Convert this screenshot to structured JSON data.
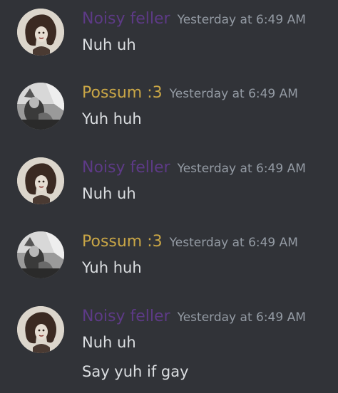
{
  "colors": {
    "background": "#313338",
    "timestamp": "#949ba4",
    "text": "#dbdee1",
    "noisy_feller": "#5d3a86",
    "possum": "#c9a646"
  },
  "messages": [
    {
      "author": "Noisy feller",
      "author_color": "#5d3a86",
      "avatar_icon": "noisy-feller-avatar",
      "timestamp": "Yesterday at 6:49 AM",
      "lines": [
        "Nuh uh"
      ]
    },
    {
      "author": "Possum :3",
      "author_color": "#c9a646",
      "avatar_icon": "possum-avatar",
      "timestamp": "Yesterday at 6:49 AM",
      "lines": [
        "Yuh huh"
      ]
    },
    {
      "author": "Noisy feller",
      "author_color": "#5d3a86",
      "avatar_icon": "noisy-feller-avatar",
      "timestamp": "Yesterday at 6:49 AM",
      "lines": [
        "Nuh uh"
      ]
    },
    {
      "author": "Possum :3",
      "author_color": "#c9a646",
      "avatar_icon": "possum-avatar",
      "timestamp": "Yesterday at 6:49 AM",
      "lines": [
        "Yuh huh"
      ]
    },
    {
      "author": "Noisy feller",
      "author_color": "#5d3a86",
      "avatar_icon": "noisy-feller-avatar",
      "timestamp": "Yesterday at 6:49 AM",
      "lines": [
        "Nuh uh",
        "Say yuh if gay"
      ]
    }
  ]
}
